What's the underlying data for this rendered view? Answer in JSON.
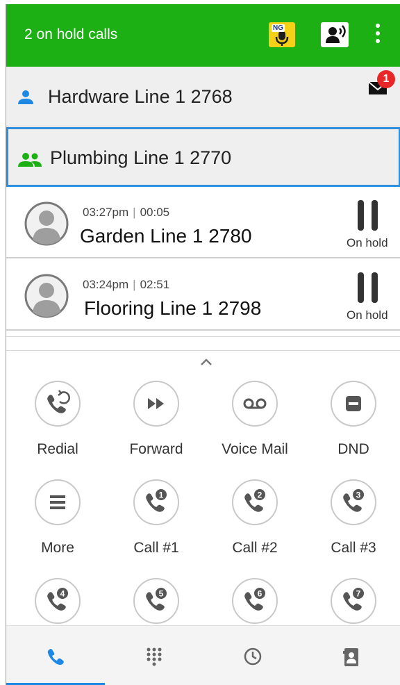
{
  "appbar": {
    "title": "2 on hold calls",
    "icons": [
      "ng-voice-icon",
      "speaker-icon",
      "overflow-menu-icon"
    ],
    "ng_label": "NG",
    "color": "#1db015"
  },
  "lines": [
    {
      "label": "Hardware Line 1 2768",
      "icon": "person-icon",
      "icon_color": "#1e88e5"
    },
    {
      "label": "Plumbing Line 1 2770",
      "icon": "group-icon",
      "icon_color": "#1db015",
      "selected": true
    }
  ],
  "mail": {
    "badge": "1",
    "badge_color": "#e82828"
  },
  "calls": [
    {
      "time": "03:27pm",
      "duration": "00:05",
      "name": "Garden Line 1 2780",
      "status": "On hold"
    },
    {
      "time": "03:24pm",
      "duration": "02:51",
      "name": "Flooring Line 1 2798",
      "status": "On hold"
    }
  ],
  "call_separator": "|",
  "actions": [
    {
      "label": "Redial",
      "icon": "redial-icon"
    },
    {
      "label": "Forward",
      "icon": "forward-icon"
    },
    {
      "label": "Voice Mail",
      "icon": "voicemail-icon"
    },
    {
      "label": "DND",
      "icon": "dnd-icon"
    },
    {
      "label": "More",
      "icon": "more-icon"
    },
    {
      "label": "Call #1",
      "icon": "speed-dial-1-icon"
    },
    {
      "label": "Call #2",
      "icon": "speed-dial-2-icon"
    },
    {
      "label": "Call #3",
      "icon": "speed-dial-3-icon"
    },
    {
      "label": "",
      "icon": "speed-dial-4-icon"
    },
    {
      "label": "",
      "icon": "speed-dial-5-icon"
    },
    {
      "label": "",
      "icon": "speed-dial-6-icon"
    },
    {
      "label": "",
      "icon": "speed-dial-7-icon"
    }
  ],
  "speed_dial_numbers": [
    "1",
    "2",
    "3",
    "4",
    "5",
    "6",
    "7"
  ],
  "bottom_nav": [
    {
      "icon": "phone-icon",
      "active": true
    },
    {
      "icon": "dialpad-icon",
      "active": false
    },
    {
      "icon": "history-icon",
      "active": false
    },
    {
      "icon": "contacts-icon",
      "active": false
    }
  ],
  "accent": "#1e88e5"
}
